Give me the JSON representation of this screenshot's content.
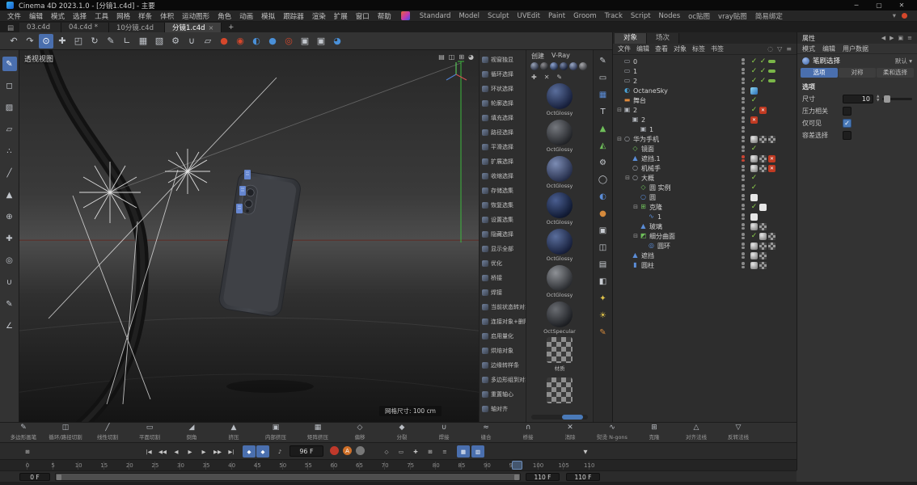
{
  "colors": {
    "accent": "#4a6fae",
    "selection_blue": "#4a7ab8",
    "check_green": "#8ed04c",
    "octane_red": "#d5472b",
    "record_red": "#c0392b",
    "autokey_orange": "#d07028",
    "axis_green": "#3db83d",
    "tag_orange": "#c03a22"
  },
  "titlebar": {
    "title": "Cinema 4D 2023.1.0 - [分镜1.c4d] - 主要",
    "minimize": "─",
    "maximize": "▢",
    "close": "✕"
  },
  "menubar": {
    "items": [
      {
        "label": "文件"
      },
      {
        "label": "编辑"
      },
      {
        "label": "模式"
      },
      {
        "label": "选择"
      },
      {
        "label": "工具"
      },
      {
        "label": "网格"
      },
      {
        "label": "样条"
      },
      {
        "label": "体积"
      },
      {
        "label": "运动图形"
      },
      {
        "label": "角色"
      },
      {
        "label": "动画"
      },
      {
        "label": "模拟"
      },
      {
        "label": "跟踪器"
      },
      {
        "label": "渲染"
      },
      {
        "label": "扩展"
      },
      {
        "label": "窗口"
      },
      {
        "label": "帮助"
      }
    ],
    "layouts": [
      {
        "label": "Standard"
      },
      {
        "label": "Model"
      },
      {
        "label": "Sculpt"
      },
      {
        "label": "UVEdit"
      },
      {
        "label": "Paint"
      },
      {
        "label": "Groom"
      },
      {
        "label": "Track"
      },
      {
        "label": "Script"
      },
      {
        "label": "Nodes"
      },
      {
        "label": "oc贴图"
      },
      {
        "label": "vray贴图"
      },
      {
        "label": "简易绑定"
      }
    ],
    "caret": "▾"
  },
  "doc_tabs": {
    "home_glyph": "▤",
    "tabs": [
      {
        "label": "03.c4d"
      },
      {
        "label": "04.c4d *"
      },
      {
        "label": "10分镜.c4d"
      },
      {
        "label": "分镜1.c4d",
        "active": true,
        "close": "×"
      }
    ],
    "add_label": "+"
  },
  "main_toolbar": {
    "items": [
      {
        "n": "undo-icon",
        "g": "↶"
      },
      {
        "n": "redo-icon",
        "g": "↷"
      },
      {
        "n": "live-selection-icon",
        "g": "⊙",
        "active": true
      },
      {
        "n": "move-icon",
        "g": "✚"
      },
      {
        "n": "scale-icon",
        "g": "◰"
      },
      {
        "n": "rotate-icon",
        "g": "↻"
      },
      {
        "n": "last-tool-icon",
        "g": "✎"
      },
      {
        "n": "coord-system-icon",
        "g": "∟"
      },
      {
        "n": "render-view-icon",
        "g": "▦"
      },
      {
        "n": "render-picture-viewer-icon",
        "g": "▧"
      },
      {
        "n": "render-settings-icon",
        "g": "⚙"
      },
      {
        "n": "magnet-snap-icon",
        "g": "∪"
      },
      {
        "n": "workplane-icon",
        "g": "▱"
      },
      {
        "n": "octane-live-viewer-icon",
        "g": "●"
      },
      {
        "n": "octane-settings-icon",
        "g": "◉"
      },
      {
        "n": "c4d-cloud-icon",
        "g": "◐"
      },
      {
        "n": "team-render-icon",
        "g": "●"
      },
      {
        "n": "octane-node-icon",
        "g": "◎"
      },
      {
        "n": "camera-morph-icon",
        "g": "▣"
      },
      {
        "n": "camera-crane-icon",
        "g": "▣"
      },
      {
        "n": "material-ball-icon",
        "g": "◕"
      }
    ]
  },
  "left_toolbar": {
    "items": [
      {
        "n": "convert-editable-icon",
        "g": "✎",
        "active": true
      },
      {
        "n": "model-mode-icon",
        "g": "◻"
      },
      {
        "n": "texture-mode-icon",
        "g": "▨"
      },
      {
        "n": "workplane-mode-icon",
        "g": "▱"
      },
      {
        "n": "points-mode-icon",
        "g": "∴"
      },
      {
        "n": "edges-mode-icon",
        "g": "╱"
      },
      {
        "n": "polygons-mode-icon",
        "g": "▲"
      },
      {
        "n": "enable-axis-icon",
        "g": "⊕"
      },
      {
        "n": "tweak-mode-icon",
        "g": "✚"
      },
      {
        "n": "solo-mode-icon",
        "g": "◎"
      },
      {
        "n": "snap-icon",
        "g": "∪"
      },
      {
        "n": "paint-brush-icon",
        "g": "✎"
      },
      {
        "n": "quantize-icon",
        "g": "∠"
      }
    ]
  },
  "viewport": {
    "label": "透视视图",
    "grid_size_label": "网格尺寸: 100 cm",
    "menu_icons": [
      {
        "n": "vp-render-icon",
        "g": "▤"
      },
      {
        "n": "vp-layout-icon",
        "g": "◫"
      },
      {
        "n": "vp-grid-icon",
        "g": "⊞"
      },
      {
        "n": "vp-options-icon",
        "g": "◕"
      }
    ]
  },
  "command_palette": {
    "items": [
      {
        "label": "视窗独显"
      },
      {
        "label": "循环选择"
      },
      {
        "label": "环状选择"
      },
      {
        "label": "轮廓选择"
      },
      {
        "label": "填充选择"
      },
      {
        "label": "路径选择"
      },
      {
        "label": "平滑选择"
      },
      {
        "label": "扩展选择"
      },
      {
        "label": "收缩选择"
      },
      {
        "label": "存储选集"
      },
      {
        "label": "恢复选集"
      },
      {
        "label": "设置选集"
      },
      {
        "label": "隐藏选择"
      },
      {
        "label": "显示全部"
      },
      {
        "label": "优化"
      },
      {
        "label": "桥接"
      },
      {
        "label": "焊接"
      },
      {
        "label": "当前状态转对象"
      },
      {
        "label": "连接对象+删除"
      },
      {
        "label": "启用量化"
      },
      {
        "label": "烘焙对象"
      },
      {
        "label": "边缘转样条"
      },
      {
        "label": "多边形组到对象"
      },
      {
        "label": "重置轴心"
      },
      {
        "label": "轴对齐"
      }
    ]
  },
  "materials": {
    "menus": [
      {
        "label": "创建"
      },
      {
        "label": "V-Ray"
      }
    ],
    "presets": [
      {
        "kind": "p1"
      },
      {
        "kind": "p2"
      },
      {
        "kind": "p3"
      },
      {
        "kind": "p4"
      },
      {
        "kind": "p5"
      },
      {
        "kind": "p6"
      }
    ],
    "tools": [
      {
        "n": "add-material-icon",
        "g": "✚"
      },
      {
        "n": "delete-material-icon",
        "g": "✕"
      },
      {
        "n": "edit-material-icon",
        "g": "✎"
      }
    ],
    "list": [
      {
        "label": "OctGlossy",
        "kind": "navy"
      },
      {
        "label": "OctGlossy",
        "kind": "charcoal"
      },
      {
        "label": "OctGlossy",
        "kind": "slate"
      },
      {
        "label": "OctGlossy",
        "kind": "deepblue"
      },
      {
        "label": "OctGlossy",
        "kind": "navy"
      },
      {
        "label": "OctGlossy",
        "kind": "gray"
      },
      {
        "label": "OctSpecular",
        "kind": "dim"
      },
      {
        "label": "材质",
        "kind": "checker"
      },
      {
        "label": "",
        "kind": "checker"
      }
    ]
  },
  "primitive_strip": {
    "items": [
      {
        "n": "pen-tool-icon",
        "g": "✎",
        "c": "w"
      },
      {
        "n": "plane-icon",
        "g": "▭",
        "c": "w"
      },
      {
        "n": "cube-icon",
        "g": "▦",
        "c": "b"
      },
      {
        "n": "text-icon",
        "g": "T",
        "c": "w"
      },
      {
        "n": "landscape-icon",
        "g": "▲",
        "c": "g"
      },
      {
        "n": "relief-icon",
        "g": "◭",
        "c": "g"
      },
      {
        "n": "gear-icon",
        "g": "⚙",
        "c": "w"
      },
      {
        "n": "circle-spline-icon",
        "g": "◯",
        "c": "w"
      },
      {
        "n": "sky-icon",
        "g": "◐",
        "c": "b"
      },
      {
        "n": "material-sphere-icon",
        "g": "●",
        "c": "o"
      },
      {
        "n": "camera-icon",
        "g": "▣",
        "c": "w"
      },
      {
        "n": "camera-add-icon",
        "g": "◫",
        "c": "w"
      },
      {
        "n": "film-camera-icon",
        "g": "▤",
        "c": "w"
      },
      {
        "n": "stage-camera-icon",
        "g": "◧",
        "c": "w"
      },
      {
        "n": "light-icon",
        "g": "✦",
        "c": "y"
      },
      {
        "n": "sun-icon",
        "g": "☀",
        "c": "y"
      },
      {
        "n": "crayon-icon",
        "g": "✎",
        "c": "o"
      }
    ]
  },
  "object_manager": {
    "tabs": [
      {
        "label": "对象",
        "active": true
      },
      {
        "label": "场次"
      }
    ],
    "menus": [
      {
        "label": "文件"
      },
      {
        "label": "编辑"
      },
      {
        "label": "查看"
      },
      {
        "label": "对象"
      },
      {
        "label": "标签"
      },
      {
        "label": "书签"
      }
    ],
    "header_icons": [
      {
        "n": "om-search-icon",
        "g": "◌"
      },
      {
        "n": "om-filter-icon",
        "g": "▽"
      },
      {
        "n": "om-menu-icon",
        "g": "≡"
      }
    ],
    "rows": [
      {
        "label": "0",
        "indent": 0,
        "icon": "display",
        "d1": "g",
        "d2": "g",
        "t1": "check",
        "t2": "check",
        "t3": "greenbar"
      },
      {
        "label": "1",
        "indent": 0,
        "icon": "display",
        "d1": "g",
        "d2": "g",
        "t1": "check",
        "t2": "check",
        "t3": "greenbar"
      },
      {
        "label": "2",
        "indent": 0,
        "icon": "display",
        "d1": "g",
        "d2": "g",
        "t1": "check",
        "t2": "check",
        "t3": "greenbar"
      },
      {
        "label": "OctaneSky",
        "indent": 0,
        "icon": "sky",
        "d1": "g",
        "d2": "g",
        "t1": "bluesq"
      },
      {
        "label": "舞台",
        "indent": 0,
        "icon": "stage",
        "d1": "g",
        "d2": "g",
        "t1": "check"
      },
      {
        "label": "2",
        "indent": 0,
        "exp": "⊟",
        "icon": "camera",
        "d1": "g",
        "d2": "g",
        "t1": "check",
        "t2": "redx"
      },
      {
        "label": "2",
        "indent": 1,
        "icon": "camera",
        "d1": "g",
        "d2": "g",
        "t1": "redx"
      },
      {
        "label": "1",
        "indent": 2,
        "icon": "camera",
        "d1": "g",
        "d2": "g"
      },
      {
        "label": "华为手机",
        "indent": 0,
        "exp": "⊟",
        "icon": "null",
        "d1": "g",
        "d2": "g",
        "t1": "phong",
        "t2": "tex",
        "t3": "tex"
      },
      {
        "label": "镜面",
        "indent": 1,
        "icon": "instance",
        "d1": "g",
        "d2": "g",
        "t1": "check"
      },
      {
        "label": "遮挡.1",
        "indent": 1,
        "icon": "poly",
        "d1": "r",
        "d2": "r",
        "t1": "phong",
        "t2": "tex",
        "t3": "redx"
      },
      {
        "label": "机械手",
        "indent": 1,
        "icon": "null",
        "d1": "g",
        "d2": "g",
        "t1": "phong",
        "t2": "tex",
        "t3": "redx"
      },
      {
        "label": "大概",
        "indent": 1,
        "exp": "⊟",
        "icon": "null",
        "d1": "g",
        "d2": "g",
        "t1": "check"
      },
      {
        "label": "圆 实例",
        "indent": 2,
        "icon": "instance",
        "d1": "g",
        "d2": "g",
        "t1": "check"
      },
      {
        "label": "圆",
        "indent": 2,
        "icon": "circle",
        "d1": "g",
        "d2": "g",
        "t1": "white"
      },
      {
        "label": "克隆",
        "indent": 2,
        "exp": "⊟",
        "icon": "cloner",
        "d1": "g",
        "d2": "g",
        "t1": "check",
        "t2": "white"
      },
      {
        "label": "1",
        "indent": 3,
        "icon": "spline",
        "d1": "g",
        "d2": "g",
        "t1": "white"
      },
      {
        "label": "玻璃",
        "indent": 2,
        "icon": "poly",
        "d1": "g",
        "d2": "g",
        "t1": "phong",
        "t2": "tex"
      },
      {
        "label": "细分曲面",
        "indent": 2,
        "exp": "⊟",
        "icon": "sds",
        "d1": "g",
        "d2": "g",
        "t1": "check",
        "t2": "phong",
        "t3": "tex"
      },
      {
        "label": "圆环",
        "indent": 3,
        "icon": "ring",
        "d1": "g",
        "d2": "g",
        "t1": "phong",
        "t2": "tex",
        "t3": "tex"
      },
      {
        "label": "遮挡",
        "indent": 1,
        "icon": "poly",
        "d1": "g",
        "d2": "g",
        "t1": "phong",
        "t2": "tex"
      },
      {
        "label": "圆柱",
        "indent": 1,
        "icon": "cylinder",
        "d1": "g",
        "d2": "g",
        "t1": "phong",
        "t2": "tex"
      }
    ]
  },
  "attributes": {
    "title": "属性",
    "header_icons": [
      {
        "n": "attr-back-icon",
        "g": "◀"
      },
      {
        "n": "attr-forward-icon",
        "g": "▶"
      },
      {
        "n": "attr-lock-icon",
        "g": "▣"
      },
      {
        "n": "attr-menu-icon",
        "g": "≡"
      }
    ],
    "menus": [
      {
        "label": "模式"
      },
      {
        "label": "编辑"
      },
      {
        "label": "用户数据"
      }
    ],
    "tool_name": "笔刷选择",
    "preset_label": "默认 ▾",
    "tabs": [
      {
        "label": "选项",
        "active": true
      },
      {
        "label": "对称"
      },
      {
        "label": "柔和选择"
      }
    ],
    "section": "选项",
    "size_label": "尺寸",
    "size_value": "10",
    "checkboxes": [
      {
        "label": "压力相关",
        "on": false
      },
      {
        "label": "仅可见",
        "on": true
      },
      {
        "label": "容差选择",
        "on": false
      }
    ]
  },
  "modeling_strip": {
    "items": [
      {
        "label": "多边形画笔",
        "g": "✎"
      },
      {
        "label": "循环/路径切割",
        "g": "◫"
      },
      {
        "label": "线性切割",
        "g": "╱"
      },
      {
        "label": "平面切割",
        "g": "▭"
      },
      {
        "label": "倒角",
        "g": "◢"
      },
      {
        "label": "挤压",
        "g": "▲"
      },
      {
        "label": "内部挤压",
        "g": "▣"
      },
      {
        "label": "矩阵挤压",
        "g": "▦"
      },
      {
        "label": "偏移",
        "g": "◇"
      },
      {
        "label": "分裂",
        "g": "◆"
      },
      {
        "label": "焊接",
        "g": "∪"
      },
      {
        "label": "缝合",
        "g": "≈"
      },
      {
        "label": "桥接",
        "g": "∩"
      },
      {
        "label": "消除",
        "g": "✕"
      },
      {
        "label": "熨烫 N-gons",
        "g": "∿"
      },
      {
        "label": "克隆",
        "g": "⊞"
      },
      {
        "label": "对齐法线",
        "g": "△"
      },
      {
        "label": "反转法线",
        "g": "▽"
      }
    ]
  },
  "transport": {
    "layout_glyph": "⊞",
    "playback": [
      {
        "n": "goto-start-button",
        "g": "|◀"
      },
      {
        "n": "prev-key-button",
        "g": "◀◀"
      },
      {
        "n": "prev-frame-button",
        "g": "◀"
      },
      {
        "n": "play-button",
        "g": "▶"
      },
      {
        "n": "next-frame-button",
        "g": "▶"
      },
      {
        "n": "next-key-button",
        "g": "▶▶"
      },
      {
        "n": "goto-end-button",
        "g": "▶|"
      }
    ],
    "toggles": [
      {
        "n": "record-active-objects-toggle",
        "g": "◆",
        "active": true
      },
      {
        "n": "keyframe-selection-toggle",
        "g": "◆",
        "active": true
      }
    ],
    "sound_glyph": "♪",
    "frame_value": "96 F",
    "record_buttons": [
      {
        "n": "record-keyframe-button",
        "kind": "red",
        "g": ""
      },
      {
        "n": "autokey-toggle",
        "kind": "orange",
        "g": "A"
      },
      {
        "n": "keyframe-store-button",
        "kind": "gray",
        "g": ""
      }
    ],
    "mid_icons": [
      {
        "n": "position-key-icon",
        "g": "◇"
      },
      {
        "n": "scale-key-icon",
        "g": "▭"
      },
      {
        "n": "rotation-key-icon",
        "g": "✚"
      },
      {
        "n": "parameter-key-icon",
        "g": "⊞"
      },
      {
        "n": "pla-key-icon",
        "g": "≡"
      }
    ],
    "end_toggles": [
      {
        "n": "snap-frame-toggle",
        "g": "▦",
        "active": true
      },
      {
        "n": "auto-tangent-toggle",
        "g": "▥",
        "active": true
      }
    ],
    "right_glyph": "▼"
  },
  "ruler": {
    "ticks": [
      {
        "label": "0"
      },
      {
        "label": "5"
      },
      {
        "label": "10"
      },
      {
        "label": "15"
      },
      {
        "label": "20"
      },
      {
        "label": "25"
      },
      {
        "label": "30"
      },
      {
        "label": "35"
      },
      {
        "label": "40"
      },
      {
        "label": "45"
      },
      {
        "label": "50"
      },
      {
        "label": "55"
      },
      {
        "label": "60"
      },
      {
        "label": "65"
      },
      {
        "label": "70"
      },
      {
        "label": "75"
      },
      {
        "label": "80"
      },
      {
        "label": "85"
      },
      {
        "label": "90"
      },
      {
        "label": "95"
      },
      {
        "label": "100"
      },
      {
        "label": "105"
      },
      {
        "label": "110"
      }
    ],
    "playhead_frame": "96"
  },
  "range_bar": {
    "start": "0 F",
    "end": "110 F",
    "end2": "110 F"
  }
}
